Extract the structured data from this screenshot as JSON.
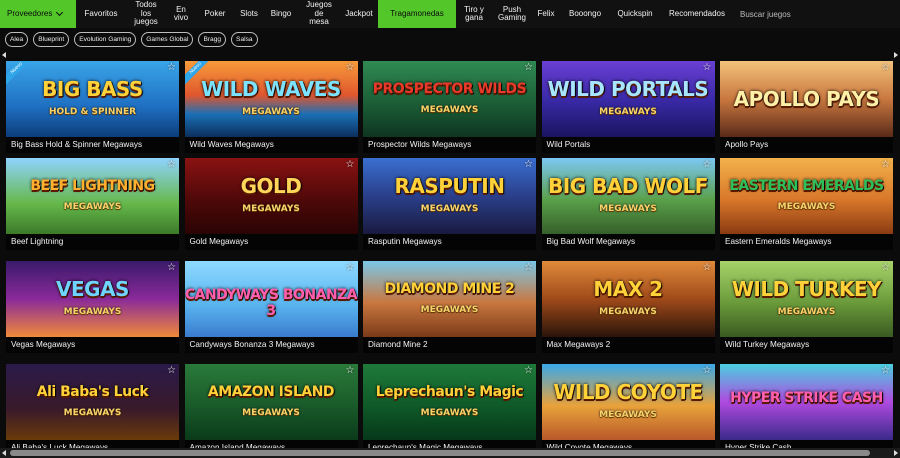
{
  "nav": {
    "items": [
      {
        "label": "Proveedores",
        "dropdown": true
      },
      {
        "label": "Favoritos"
      },
      {
        "label": "Todos\nlos\njuegos"
      },
      {
        "label": "En\nvivo"
      },
      {
        "label": "Poker"
      },
      {
        "label": "Slots"
      },
      {
        "label": "Bingo"
      },
      {
        "label": "Juegos\nde\nmesa"
      },
      {
        "label": "Jackpot"
      },
      {
        "label": "Tragamonedas",
        "active": true
      },
      {
        "label": "Tiro y\ngana"
      },
      {
        "label": "Push\nGaming"
      },
      {
        "label": "Felix"
      },
      {
        "label": "Booongo"
      },
      {
        "label": "Quickspin"
      },
      {
        "label": "Recomendados"
      }
    ],
    "search_placeholder": "Buscar juegos"
  },
  "chips": [
    "Alea",
    "Blueprint",
    "Evolution Gaming",
    "Games Global",
    "Bragg",
    "Salsa"
  ],
  "accent_color": "#53c62a",
  "games": [
    {
      "name": "Big Bass Hold & Spinner Megaways",
      "logo": "BIG BASS",
      "logo_sub": "HOLD & SPINNER",
      "badge": "Nuevo",
      "bg": "linear-gradient(180deg,#3aa5e8 0%,#1f6fc2 60%,#0c3d7a 100%)",
      "logo_color": "#ffd23a"
    },
    {
      "name": "Wild Waves Megaways",
      "logo": "WILD WAVES",
      "logo_sub": "MEGAWAYS",
      "badge": "Nuevo",
      "bg": "linear-gradient(180deg,#f79b3a 0%,#e0562e 45%,#1b6fb5 70%,#0b2e5c 100%)",
      "logo_color": "#7be3ff"
    },
    {
      "name": "Prospector Wilds Megaways",
      "logo": "PROSPECTOR WILDS",
      "logo_sub": "MEGAWAYS",
      "bg": "linear-gradient(180deg,#2f8a52 0%,#1a5a34 60%,#0e3520 100%)",
      "logo_color": "#e83a2a"
    },
    {
      "name": "Wild Portals",
      "logo": "WILD PORTALS",
      "logo_sub": "MEGAWAYS",
      "bg": "linear-gradient(180deg,#6a3fd3 0%,#3a2aa8 50%,#1a1460 100%)",
      "logo_color": "#a8e6ff"
    },
    {
      "name": "Apollo Pays",
      "logo": "APOLLO PAYS",
      "logo_sub": "",
      "bg": "linear-gradient(180deg,#f3c27b 0%,#c9783f 50%,#5a2a18 100%)",
      "logo_color": "#fff0a8"
    },
    {
      "name": "Beef Lightning",
      "logo": "BEEF LIGHTNING",
      "logo_sub": "MEGAWAYS",
      "bg": "linear-gradient(180deg,#8fd3ff 0%,#66b84a 60%,#3b7a2a 100%)",
      "logo_color": "#ffb02e"
    },
    {
      "name": "Gold Megaways",
      "logo": "GOLD",
      "logo_sub": "MEGAWAYS",
      "bg": "linear-gradient(180deg,#8a1212 0%,#4a0808 60%,#2a0404 100%)",
      "logo_color": "#ffd65a"
    },
    {
      "name": "Rasputin Megaways",
      "logo": "RASPUTIN",
      "logo_sub": "MEGAWAYS",
      "bg": "linear-gradient(180deg,#3a6fd1 0%,#2a3f8a 50%,#1a1a40 100%)",
      "logo_color": "#ffd23a"
    },
    {
      "name": "Big Bad Wolf Megaways",
      "logo": "BIG BAD WOLF",
      "logo_sub": "MEGAWAYS",
      "bg": "linear-gradient(180deg,#7cc8f5 0%,#5aa04a 55%,#355f2a 100%)",
      "logo_color": "#ffd23a"
    },
    {
      "name": "Eastern Emeralds Megaways",
      "logo": "EASTERN EMERALDS",
      "logo_sub": "MEGAWAYS",
      "bg": "linear-gradient(180deg,#f3b24a 0%,#d8772a 55%,#8a3a12 100%)",
      "logo_color": "#2fbf5a"
    },
    {
      "name": "Vegas Megaways",
      "logo": "VEGAS",
      "logo_sub": "MEGAWAYS",
      "bg": "linear-gradient(180deg,#3a1a6a 0%,#8a2a9a 50%,#f08a3a 100%)",
      "logo_color": "#6fd5ff"
    },
    {
      "name": "Candyways Bonanza 3 Megaways",
      "logo": "CANDYWAYS BONANZA 3",
      "logo_sub": "",
      "bg": "linear-gradient(180deg,#8ed9ff 0%,#5cb7f0 55%,#3a7ccf 100%)",
      "logo_color": "#ff5fae"
    },
    {
      "name": "Diamond Mine 2",
      "logo": "DIAMOND MINE 2",
      "logo_sub": "MEGAWAYS",
      "bg": "linear-gradient(180deg,#7ac7e8 0%,#c9773f 55%,#7a3a18 100%)",
      "logo_color": "#ffd23a"
    },
    {
      "name": "Max Megaways 2",
      "logo": "MAX 2",
      "logo_sub": "MEGAWAYS",
      "bg": "linear-gradient(180deg,#e08a3a 0%,#a04a1a 50%,#2a140a 100%)",
      "logo_color": "#ffd23a"
    },
    {
      "name": "Wild Turkey Megaways",
      "logo": "WILD TURKEY",
      "logo_sub": "MEGAWAYS",
      "bg": "linear-gradient(180deg,#a8d36a 0%,#6a9a3a 55%,#3a5a22 100%)",
      "logo_color": "#ffd23a"
    },
    {
      "name": "Ali Baba's Luck Megaways",
      "logo": "Ali Baba's Luck",
      "logo_sub": "MEGAWAYS",
      "bg": "linear-gradient(180deg,#2a1a4a 0%,#3a1a2a 60%,#6a3a0a 100%)",
      "logo_color": "#ffd23a"
    },
    {
      "name": "Amazon Island Megaways",
      "logo": "AMAZON ISLAND",
      "logo_sub": "MEGAWAYS",
      "bg": "linear-gradient(180deg,#2a7a3a 0%,#1a5a2a 55%,#0a3a1a 100%)",
      "logo_color": "#ffd23a"
    },
    {
      "name": "Leprechaun's Magic Megaways",
      "logo": "Leprechaun's Magic",
      "logo_sub": "MEGAWAYS",
      "bg": "linear-gradient(180deg,#1f7a3a 0%,#0f5a28 55%,#06381a 100%)",
      "logo_color": "#ffd23a"
    },
    {
      "name": "Wild Coyote Megaways",
      "logo": "WILD COYOTE",
      "logo_sub": "MEGAWAYS",
      "bg": "linear-gradient(180deg,#3aa8e8 0%,#e8a23a 55%,#b8582a 100%)",
      "logo_color": "#ffd23a"
    },
    {
      "name": "Hyper Strike Cash",
      "logo": "HYPER STRIKE CASH",
      "logo_sub": "",
      "bg": "linear-gradient(180deg,#4ad0e0 0%,#b04ae0 50%,#3a2a8a 100%)",
      "logo_color": "#ff5fae"
    }
  ]
}
